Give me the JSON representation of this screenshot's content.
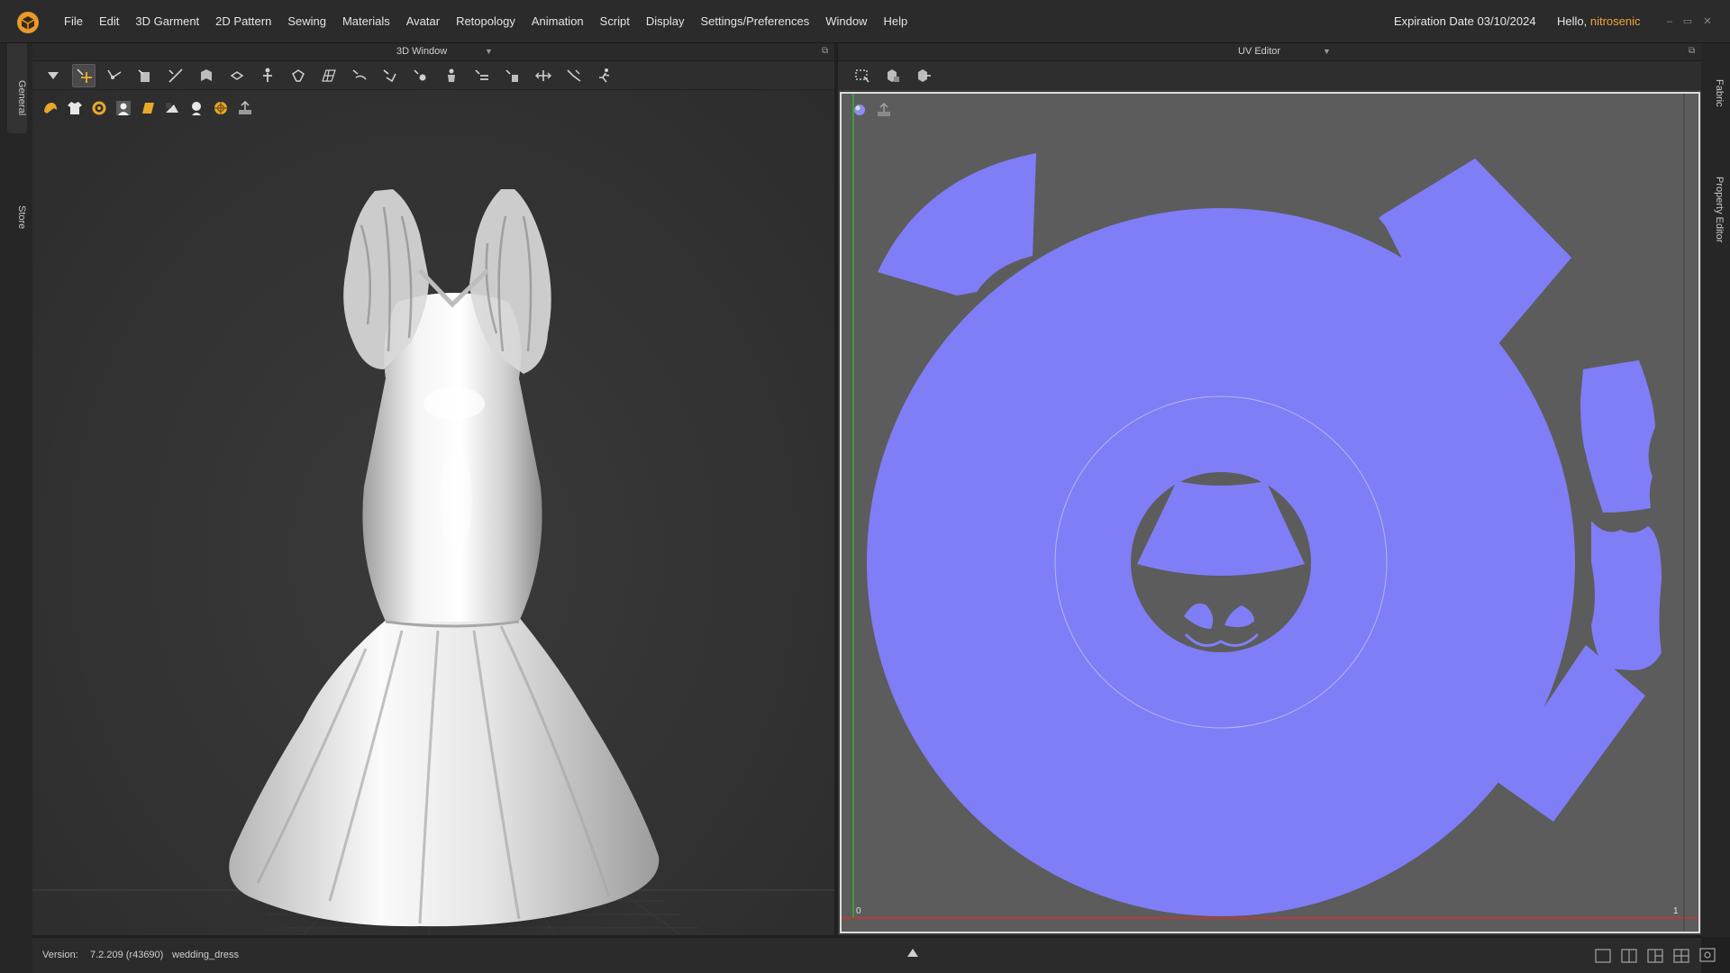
{
  "menubar": {
    "items": [
      "File",
      "Edit",
      "3D Garment",
      "2D Pattern",
      "Sewing",
      "Materials",
      "Avatar",
      "Retopology",
      "Animation",
      "Script",
      "Display",
      "Settings/Preferences",
      "Window",
      "Help"
    ],
    "expiration": "Expiration Date 03/10/2024",
    "greeting_prefix": "Hello, ",
    "user_name": "nitrosenic",
    "window_controls": [
      "–",
      "▭",
      "✕"
    ]
  },
  "left_tabs": {
    "general": "General",
    "store": "Store"
  },
  "right_tabs": {
    "fabric": "Fabric",
    "property_editor": "Property Editor"
  },
  "panel_3d": {
    "title": "3D Window",
    "tools": [
      "select-move-icon",
      "transform-icon",
      "edit-point-icon",
      "tack-icon",
      "straight-line-icon",
      "fold-icon",
      "pin-icon",
      "avatar-measure-icon",
      "fitting-icon",
      "grid-icon",
      "style-line-icon",
      "sewing-icon",
      "ease-icon",
      "button-icon",
      "topstitch-icon",
      "puckering-icon",
      "trim-icon",
      "fold-arrange-icon",
      "strap-icon",
      "animation-icon"
    ],
    "quick_icons": [
      "hair-icon",
      "garment-icon",
      "trim-visibility-icon",
      "avatar-icon",
      "shoes-icon",
      "texture-icon",
      "avatar-skin-icon",
      "arrange-icon",
      "export-icon"
    ]
  },
  "panel_uv": {
    "title": "UV Editor",
    "tools": [
      "uv-select-icon",
      "uv-transform-icon",
      "uv-arrange-icon"
    ],
    "quick_icons": [
      "texture-ball-icon",
      "export-icon"
    ],
    "axis_origin_label": "0",
    "axis_end_label": "1"
  },
  "colors": {
    "uv_fill": "#7f7ef6",
    "uv_background": "#5c5c5c",
    "accent_orange": "#f1a33a",
    "axis_green": "#2db52d",
    "axis_red": "#d23030"
  },
  "statusbar": {
    "version_label": "Version:",
    "version_value": "7.2.209 (r43690)",
    "file_name": "wedding_dress"
  }
}
